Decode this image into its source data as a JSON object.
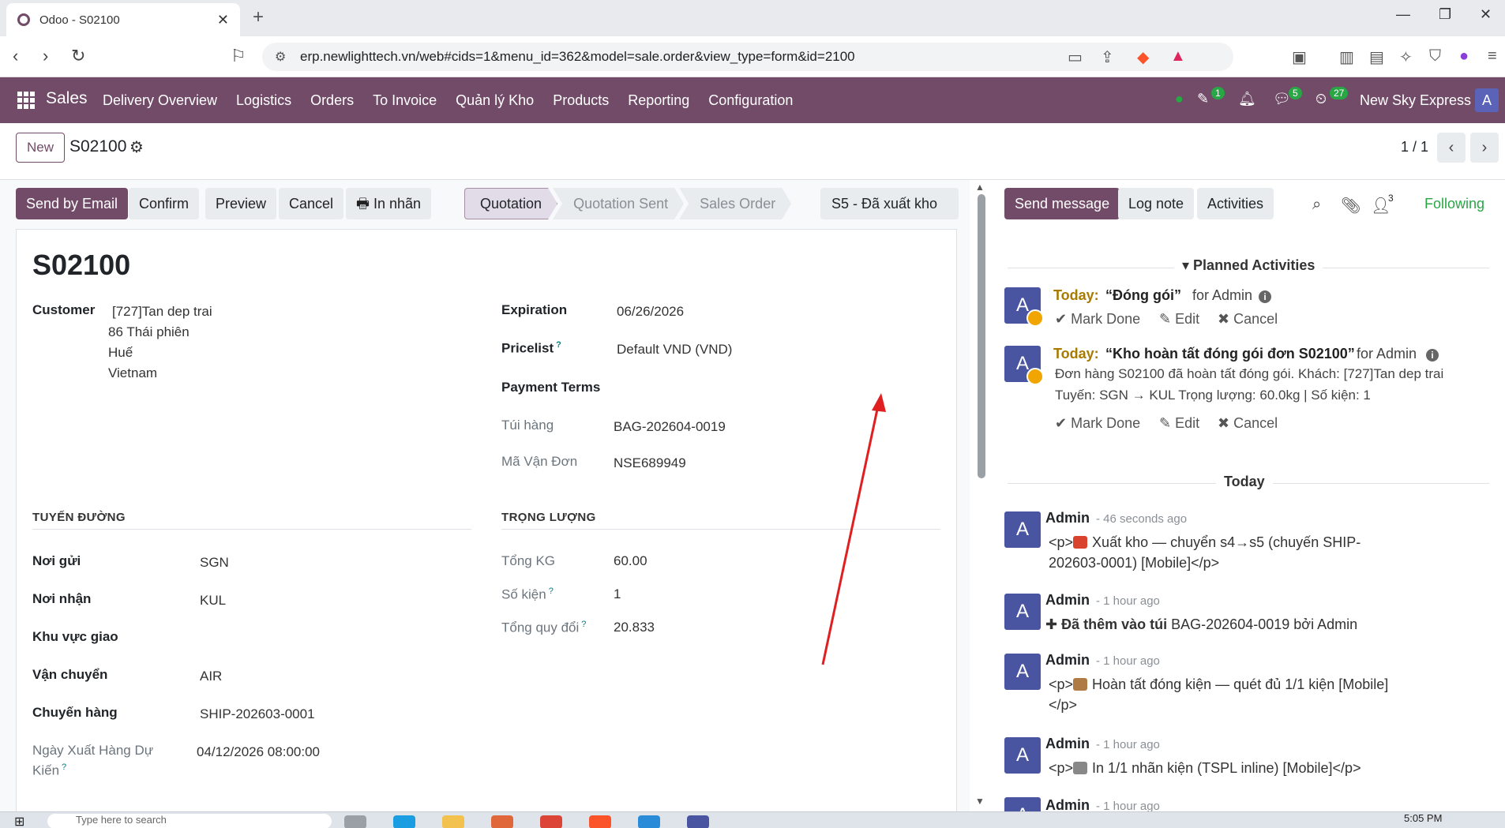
{
  "browser": {
    "tab_title": "Odoo - S02100",
    "url": "erp.newlighttech.vn/web#cids=1&menu_id=362&model=sale.order&view_type=form&id=2100"
  },
  "navbar": {
    "app_name": "Sales",
    "menu": [
      "Delivery Overview",
      "Logistics",
      "Orders",
      "To Invoice",
      "Quản lý Kho",
      "Products",
      "Reporting",
      "Configuration"
    ],
    "activity_count": "1",
    "message_count": "5",
    "clock_count": "27",
    "company": "New Sky Express",
    "user_initial": "A"
  },
  "control_panel": {
    "new_label": "New",
    "record_name": "S02100",
    "pager": "1 / 1"
  },
  "actions": {
    "send_email": "Send by Email",
    "confirm": "Confirm",
    "preview": "Preview",
    "cancel": "Cancel",
    "print_label": "In nhãn"
  },
  "stages": [
    "Quotation",
    "Quotation Sent",
    "Sales Order"
  ],
  "custom_stage": "S5 - Đã xuất kho",
  "form": {
    "title": "S02100",
    "customer_label": "Customer",
    "customer_lines": [
      "[727]Tan dep trai",
      "86 Thái phiên",
      "Huế",
      "Vietnam"
    ],
    "expiration_label": "Expiration",
    "expiration": "06/26/2026",
    "pricelist_label": "Pricelist",
    "pricelist": "Default VND (VND)",
    "payment_terms_label": "Payment Terms",
    "bag_label": "Túi hàng",
    "bag": "BAG-202604-0019",
    "waybill_label": "Mã Vận Đơn",
    "waybill": "NSE689949",
    "route_section": "TUYẾN ĐƯỜNG",
    "weight_section": "TRỌNG LƯỢNG",
    "origin_label": "Nơi gửi",
    "origin": "SGN",
    "dest_label": "Nơi nhận",
    "dest": "KUL",
    "zone_label": "Khu vực giao",
    "transport_label": "Vận chuyển",
    "transport": "AIR",
    "shipment_label": "Chuyến hàng",
    "shipment": "SHIP-202603-0001",
    "eta_label_1": "Ngày Xuất Hàng Dự",
    "eta_label_2": "Kiến",
    "eta": "04/12/2026 08:00:00",
    "total_kg_label": "Tổng KG",
    "total_kg": "60.00",
    "pieces_label": "Số kiện",
    "pieces": "1",
    "converted_label": "Tổng quy đổi",
    "converted": "20.833"
  },
  "chatter": {
    "send_message": "Send message",
    "log_note": "Log note",
    "activities": "Activities",
    "followers_count": "3",
    "following": "Following",
    "planned_header": "Planned Activities",
    "today_header": "Today",
    "activities_list": [
      {
        "today": "Today:",
        "title": "“Đóng gói”",
        "for": "for Admin",
        "mark_done": "Mark Done",
        "edit": "Edit",
        "cancel": "Cancel"
      },
      {
        "today": "Today:",
        "title": "“Kho hoàn tất đóng gói đơn S02100”",
        "for": "for Admin",
        "body_1": "Đơn hàng S02100 đã hoàn tất đóng gói. Khách: [727]Tan dep trai",
        "body_2": "Tuyến: SGN → KUL Trọng lượng: 60.0kg | Số kiện: 1",
        "mark_done": "Mark Done",
        "edit": "Edit",
        "cancel": "Cancel"
      }
    ],
    "messages": [
      {
        "author": "Admin",
        "ago": "- 46 seconds ago",
        "line_1": "<p>",
        "line_1b": "Xuất kho — chuyển s4→s5 (chuyến SHIP-",
        "line_2": "202603-0001) [Mobile]</p>"
      },
      {
        "author": "Admin",
        "ago": "- 1 hour ago",
        "bold": "Đã thêm vào túi",
        "rest": "BAG-202604-0019 bởi Admin"
      },
      {
        "author": "Admin",
        "ago": "- 1 hour ago",
        "line_1": "<p>",
        "line_1b": "Hoàn tất đóng kiện — quét đủ 1/1 kiện [Mobile]",
        "line_2": "</p>"
      },
      {
        "author": "Admin",
        "ago": "- 1 hour ago",
        "line_1": "<p>",
        "line_1b": "In 1/1 nhãn kiện (TSPL inline) [Mobile]</p>"
      },
      {
        "author": "Admin",
        "ago": "- 1 hour ago"
      }
    ]
  },
  "taskbar": {
    "search_placeholder": "Type here to search",
    "time": "5:05 PM"
  },
  "colors": {
    "brand": "#714b67",
    "avatar": "#4a55a2",
    "following": "#28a745",
    "annotation_arrow": "#e02020"
  }
}
